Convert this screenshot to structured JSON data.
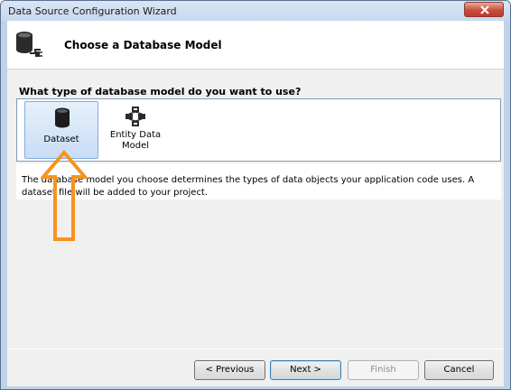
{
  "window": {
    "title": "Data Source Configuration Wizard"
  },
  "header": {
    "title": "Choose a Database Model",
    "icon": "database-connect-icon"
  },
  "question": "What type of database model do you want to use?",
  "models": [
    {
      "label": "Dataset",
      "icon": "database-icon",
      "selected": true
    },
    {
      "label_line1": "Entity Data",
      "label_line2": "Model",
      "icon": "entity-model-icon",
      "selected": false
    }
  ],
  "description": "The database model you choose determines the types of data objects your application code uses. A dataset file will be added to your project.",
  "buttons": {
    "previous": "< Previous",
    "next": "Next >",
    "finish": "Finish",
    "cancel": "Cancel"
  },
  "colors": {
    "highlight_arrow": "#f7931e",
    "selection": "#c9ddf6",
    "close_button": "#c94f3d"
  }
}
